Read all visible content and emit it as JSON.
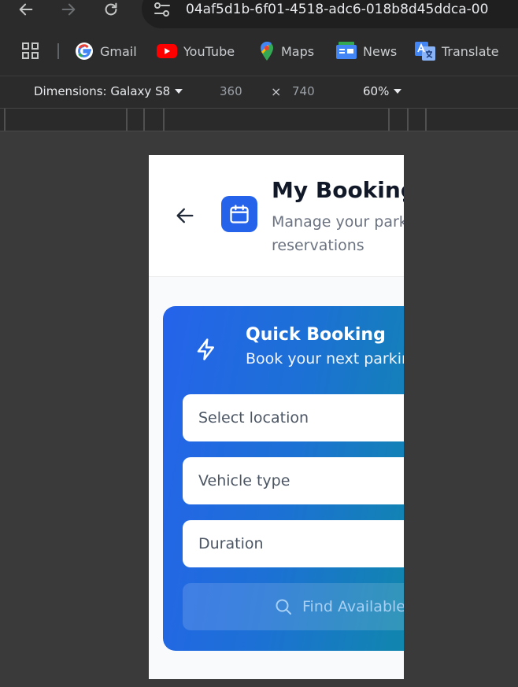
{
  "browser": {
    "url": "04af5d1b-6f01-4518-adc6-018b8d45ddca-00",
    "bookmarks": [
      {
        "label": "Gmail"
      },
      {
        "label": "YouTube"
      },
      {
        "label": "Maps"
      },
      {
        "label": "News"
      },
      {
        "label": "Translate"
      }
    ]
  },
  "devtools": {
    "device_label": "Dimensions: Galaxy S8",
    "width": "360",
    "times": "×",
    "height": "740",
    "zoom": "60%"
  },
  "app": {
    "header": {
      "title": "My Bookings",
      "subtitle": "Manage your parking reservations"
    },
    "quick_booking": {
      "title": "Quick Booking",
      "subtitle": "Book your next parking",
      "location_placeholder": "Select location",
      "vehicle_placeholder": "Vehicle type",
      "duration_placeholder": "Duration",
      "find_label": "Find Available"
    }
  },
  "colors": {
    "primary": "#2563eb",
    "gradient_end": "#0e8aa6",
    "browser_bg": "#2b2b2b"
  }
}
